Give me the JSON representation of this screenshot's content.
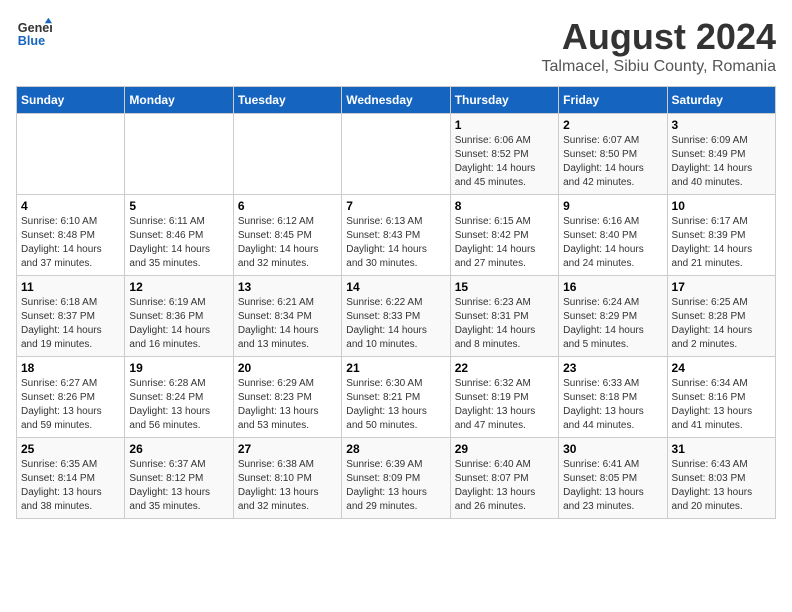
{
  "header": {
    "logo_general": "General",
    "logo_blue": "Blue",
    "main_title": "August 2024",
    "subtitle": "Talmacel, Sibiu County, Romania"
  },
  "calendar": {
    "weekdays": [
      "Sunday",
      "Monday",
      "Tuesday",
      "Wednesday",
      "Thursday",
      "Friday",
      "Saturday"
    ],
    "weeks": [
      [
        {
          "day": "",
          "info": ""
        },
        {
          "day": "",
          "info": ""
        },
        {
          "day": "",
          "info": ""
        },
        {
          "day": "",
          "info": ""
        },
        {
          "day": "1",
          "info": "Sunrise: 6:06 AM\nSunset: 8:52 PM\nDaylight: 14 hours\nand 45 minutes."
        },
        {
          "day": "2",
          "info": "Sunrise: 6:07 AM\nSunset: 8:50 PM\nDaylight: 14 hours\nand 42 minutes."
        },
        {
          "day": "3",
          "info": "Sunrise: 6:09 AM\nSunset: 8:49 PM\nDaylight: 14 hours\nand 40 minutes."
        }
      ],
      [
        {
          "day": "4",
          "info": "Sunrise: 6:10 AM\nSunset: 8:48 PM\nDaylight: 14 hours\nand 37 minutes."
        },
        {
          "day": "5",
          "info": "Sunrise: 6:11 AM\nSunset: 8:46 PM\nDaylight: 14 hours\nand 35 minutes."
        },
        {
          "day": "6",
          "info": "Sunrise: 6:12 AM\nSunset: 8:45 PM\nDaylight: 14 hours\nand 32 minutes."
        },
        {
          "day": "7",
          "info": "Sunrise: 6:13 AM\nSunset: 8:43 PM\nDaylight: 14 hours\nand 30 minutes."
        },
        {
          "day": "8",
          "info": "Sunrise: 6:15 AM\nSunset: 8:42 PM\nDaylight: 14 hours\nand 27 minutes."
        },
        {
          "day": "9",
          "info": "Sunrise: 6:16 AM\nSunset: 8:40 PM\nDaylight: 14 hours\nand 24 minutes."
        },
        {
          "day": "10",
          "info": "Sunrise: 6:17 AM\nSunset: 8:39 PM\nDaylight: 14 hours\nand 21 minutes."
        }
      ],
      [
        {
          "day": "11",
          "info": "Sunrise: 6:18 AM\nSunset: 8:37 PM\nDaylight: 14 hours\nand 19 minutes."
        },
        {
          "day": "12",
          "info": "Sunrise: 6:19 AM\nSunset: 8:36 PM\nDaylight: 14 hours\nand 16 minutes."
        },
        {
          "day": "13",
          "info": "Sunrise: 6:21 AM\nSunset: 8:34 PM\nDaylight: 14 hours\nand 13 minutes."
        },
        {
          "day": "14",
          "info": "Sunrise: 6:22 AM\nSunset: 8:33 PM\nDaylight: 14 hours\nand 10 minutes."
        },
        {
          "day": "15",
          "info": "Sunrise: 6:23 AM\nSunset: 8:31 PM\nDaylight: 14 hours\nand 8 minutes."
        },
        {
          "day": "16",
          "info": "Sunrise: 6:24 AM\nSunset: 8:29 PM\nDaylight: 14 hours\nand 5 minutes."
        },
        {
          "day": "17",
          "info": "Sunrise: 6:25 AM\nSunset: 8:28 PM\nDaylight: 14 hours\nand 2 minutes."
        }
      ],
      [
        {
          "day": "18",
          "info": "Sunrise: 6:27 AM\nSunset: 8:26 PM\nDaylight: 13 hours\nand 59 minutes."
        },
        {
          "day": "19",
          "info": "Sunrise: 6:28 AM\nSunset: 8:24 PM\nDaylight: 13 hours\nand 56 minutes."
        },
        {
          "day": "20",
          "info": "Sunrise: 6:29 AM\nSunset: 8:23 PM\nDaylight: 13 hours\nand 53 minutes."
        },
        {
          "day": "21",
          "info": "Sunrise: 6:30 AM\nSunset: 8:21 PM\nDaylight: 13 hours\nand 50 minutes."
        },
        {
          "day": "22",
          "info": "Sunrise: 6:32 AM\nSunset: 8:19 PM\nDaylight: 13 hours\nand 47 minutes."
        },
        {
          "day": "23",
          "info": "Sunrise: 6:33 AM\nSunset: 8:18 PM\nDaylight: 13 hours\nand 44 minutes."
        },
        {
          "day": "24",
          "info": "Sunrise: 6:34 AM\nSunset: 8:16 PM\nDaylight: 13 hours\nand 41 minutes."
        }
      ],
      [
        {
          "day": "25",
          "info": "Sunrise: 6:35 AM\nSunset: 8:14 PM\nDaylight: 13 hours\nand 38 minutes."
        },
        {
          "day": "26",
          "info": "Sunrise: 6:37 AM\nSunset: 8:12 PM\nDaylight: 13 hours\nand 35 minutes."
        },
        {
          "day": "27",
          "info": "Sunrise: 6:38 AM\nSunset: 8:10 PM\nDaylight: 13 hours\nand 32 minutes."
        },
        {
          "day": "28",
          "info": "Sunrise: 6:39 AM\nSunset: 8:09 PM\nDaylight: 13 hours\nand 29 minutes."
        },
        {
          "day": "29",
          "info": "Sunrise: 6:40 AM\nSunset: 8:07 PM\nDaylight: 13 hours\nand 26 minutes."
        },
        {
          "day": "30",
          "info": "Sunrise: 6:41 AM\nSunset: 8:05 PM\nDaylight: 13 hours\nand 23 minutes."
        },
        {
          "day": "31",
          "info": "Sunrise: 6:43 AM\nSunset: 8:03 PM\nDaylight: 13 hours\nand 20 minutes."
        }
      ]
    ]
  }
}
